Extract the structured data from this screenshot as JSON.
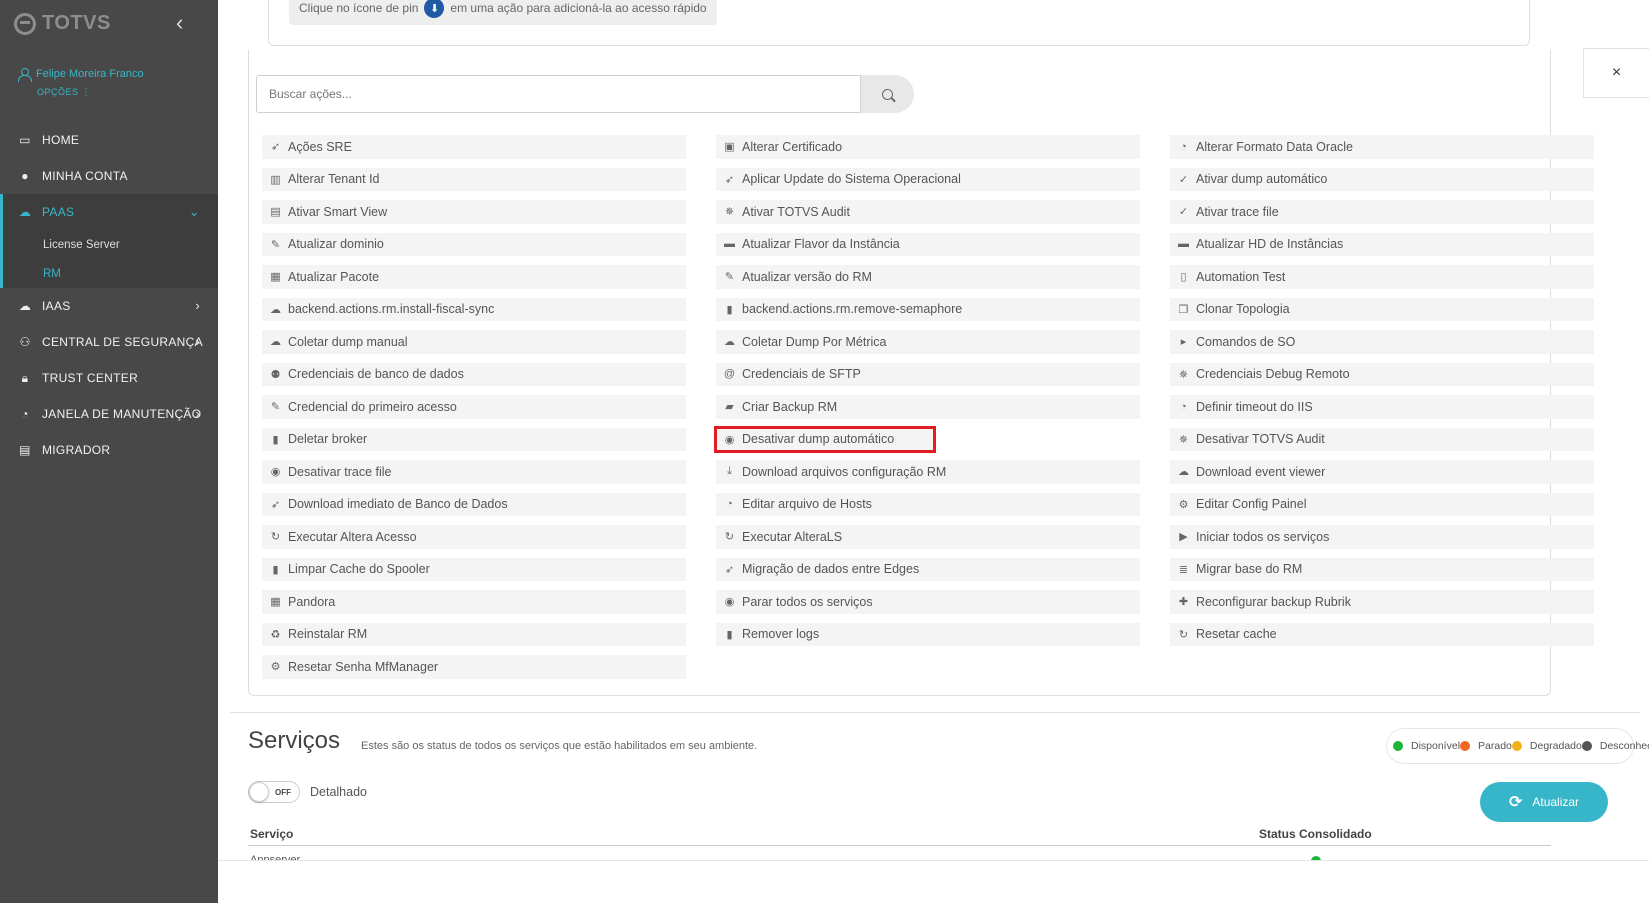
{
  "brand": {
    "logo_text": "TOTVS",
    "accent": "#36b6c8"
  },
  "user": {
    "name": "Felipe Moreira Franco",
    "options_label": "OPÇÕES ⋮"
  },
  "nav": [
    {
      "label": "HOME",
      "icon": "monitor-icon"
    },
    {
      "label": "MINHA CONTA",
      "icon": "user-icon"
    },
    {
      "label": "PAAS",
      "icon": "cloud-icon",
      "active": true,
      "arrow": "⌄"
    },
    {
      "label": "IAAS",
      "icon": "cloud-icon",
      "arrow": "›"
    },
    {
      "label": "CENTRAL DE SEGURANÇA",
      "icon": "users-lock-icon",
      "arrow": "›"
    },
    {
      "label": "TRUST CENTER",
      "icon": "lock-icon"
    },
    {
      "label": "JANELA DE MANUTENÇÃO",
      "icon": "clock-icon",
      "arrow": "›"
    },
    {
      "label": "MIGRADOR",
      "icon": "chart-icon"
    }
  ],
  "subnav": [
    {
      "label": "License Server"
    },
    {
      "label": "RM",
      "active": true
    }
  ],
  "tip": {
    "before": "Clique no ícone de pin",
    "after": "em uma ação para adicioná-la ao acesso rápido"
  },
  "search": {
    "placeholder": "Buscar ações..."
  },
  "actions": [
    [
      "Ações SRE",
      "Alterar Certificado",
      "Alterar Formato Data Oracle"
    ],
    [
      "Alterar Tenant Id",
      "Aplicar Update do Sistema Operacional",
      "Ativar dump automático"
    ],
    [
      "Ativar Smart View",
      "Ativar TOTVS Audit",
      "Ativar trace file"
    ],
    [
      "Atualizar dominio",
      "Atualizar Flavor da Instância",
      "Atualizar HD de Instâncias"
    ],
    [
      "Atualizar Pacote",
      "Atualizar versão do RM",
      "Automation Test"
    ],
    [
      "backend.actions.rm.install-fiscal-sync",
      "backend.actions.rm.remove-semaphore",
      "Clonar Topologia"
    ],
    [
      "Coletar dump manual",
      "Coletar Dump Por Métrica",
      "Comandos de SO"
    ],
    [
      "Credenciais de banco de dados",
      "Credenciais de SFTP",
      "Credenciais Debug Remoto"
    ],
    [
      "Credencial do primeiro acesso",
      "Criar Backup RM",
      "Definir timeout do IIS"
    ],
    [
      "Deletar broker",
      "Desativar dump automático",
      "Desativar TOTVS Audit"
    ],
    [
      "Desativar trace file",
      "Download arquivos configuração RM",
      "Download event viewer"
    ],
    [
      "Download imediato de Banco de Dados",
      "Editar arquivo de Hosts",
      "Editar Config Painel"
    ],
    [
      "Executar Altera Acesso",
      "Executar AlteraLS",
      "Iniciar todos os serviços"
    ],
    [
      "Limpar Cache do Spooler",
      "Migração de dados entre Edges",
      "Migrar base do RM"
    ],
    [
      "Pandora",
      "Parar todos os serviços",
      "Reconfigurar backup Rubrik"
    ],
    [
      "Reinstalar RM",
      "Remover logs",
      "Resetar cache"
    ],
    [
      "Resetar Senha MfManager",
      null,
      null
    ]
  ],
  "action_icons": [
    [
      "rocket-icon",
      "certificate-icon",
      "clock-icon"
    ],
    [
      "id-card-icon",
      "rocket-icon",
      "check-icon"
    ],
    [
      "chart-icon",
      "bug-icon",
      "check-icon"
    ],
    [
      "wrench-icon",
      "server-icon",
      "server-icon"
    ],
    [
      "package-icon",
      "wrench-icon",
      "file-icon"
    ],
    [
      "cloud-icon",
      "trash-icon",
      "copy-icon"
    ],
    [
      "cloud-download-icon",
      "cloud-download-icon",
      "caret-right-icon"
    ],
    [
      "users-icon",
      "at-icon",
      "bug-icon"
    ],
    [
      "wrench-icon",
      "folder-icon",
      "clock-icon"
    ],
    [
      "trash-icon",
      "stop-circle-icon",
      "bug-icon"
    ],
    [
      "stop-circle-icon",
      "download-icon",
      "cloud-download-icon"
    ],
    [
      "rocket-icon",
      "clock-icon",
      "gear-icon"
    ],
    [
      "refresh-icon",
      "refresh-icon",
      "play-circle-icon"
    ],
    [
      "trash-icon",
      "rocket-icon",
      "database-icon"
    ],
    [
      "package-icon",
      "stop-circle-icon",
      "puzzle-icon"
    ],
    [
      "recycle-icon",
      "trash-icon",
      "refresh-icon"
    ],
    [
      "user-gear-icon",
      null,
      null
    ]
  ],
  "highlighted_action": "Desativar dump automático",
  "services": {
    "title": "Serviços",
    "description": "Estes são os status de todos os serviços que estão habilitados em seu ambiente.",
    "legend": [
      {
        "label": "Disponível",
        "color": "#1bb636"
      },
      {
        "label": "Parado",
        "color": "#f26522"
      },
      {
        "label": "Degradado",
        "color": "#f2b118"
      },
      {
        "label": "Desconhecido",
        "color": "#555555"
      }
    ],
    "toggle_state": "OFF",
    "toggle_label": "Detalhado",
    "refresh_label": "Atualizar",
    "col_service": "Serviço",
    "col_status": "Status Consolidado",
    "first_row": "Appserver"
  },
  "close_label": "×"
}
